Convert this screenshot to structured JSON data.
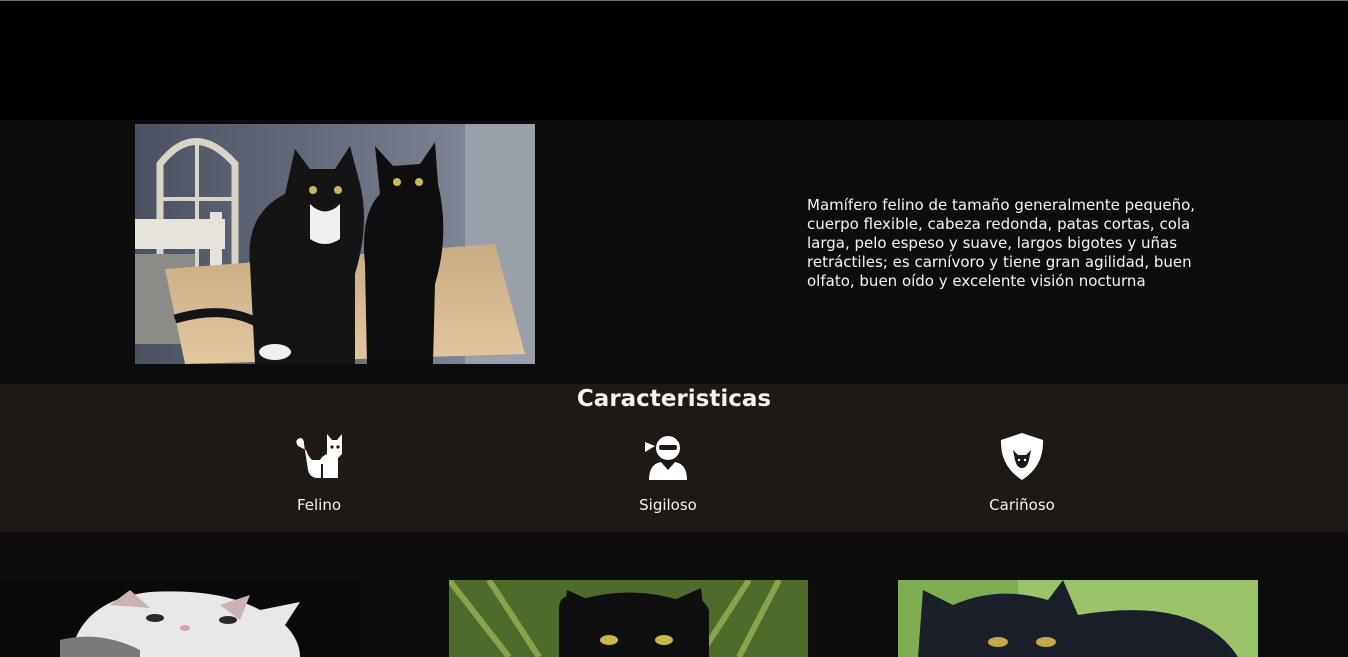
{
  "hero": {
    "image_alt": "two black cats on a table",
    "description": "Mamífero felino de tamaño generalmente pequeño, cuerpo flexible, cabeza redonda, patas cortas, cola larga, pelo espeso y suave, largos bigotes y uñas retráctiles; es carnívoro y tiene gran agilidad, buen olfato, buen oído y excelente visión nocturna"
  },
  "features": {
    "title": "Caracteristicas",
    "items": [
      {
        "label": "Felino",
        "icon": "cat-icon"
      },
      {
        "label": "Sigiloso",
        "icon": "ninja-icon"
      },
      {
        "label": "Cariñoso",
        "icon": "cat-shield-icon"
      }
    ]
  },
  "gallery": {
    "images": [
      {
        "alt": "white and grey kitten"
      },
      {
        "alt": "black cat in grass"
      },
      {
        "alt": "black cat outdoors"
      }
    ]
  },
  "colors": {
    "header_bg": "#000000",
    "page_bg": "#0d0d0d",
    "features_bg": "#1e1914",
    "text": "#f2f2f2"
  }
}
